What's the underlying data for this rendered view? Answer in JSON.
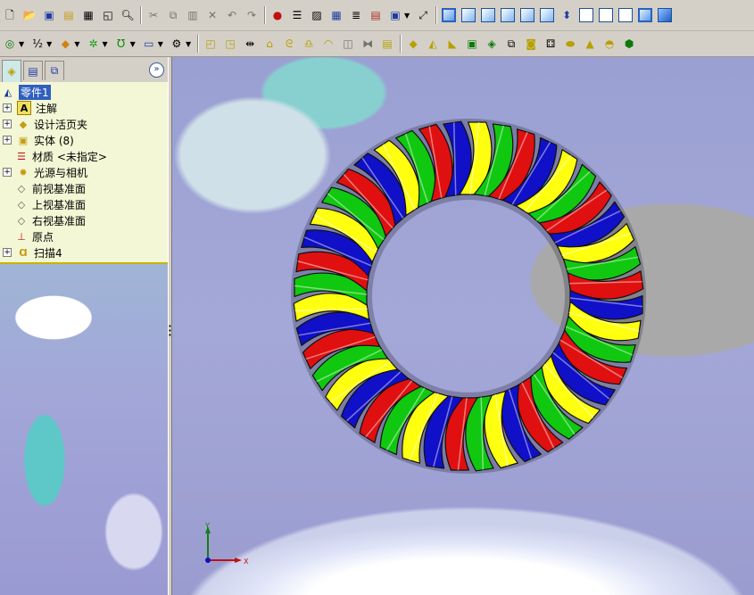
{
  "toolbar_top": {
    "file_icons": [
      "new-icon",
      "open-icon",
      "save-icon",
      "open-folder-icon",
      "print-icon",
      "print-preview-icon",
      "zoom-icon"
    ],
    "edit_icons": [
      "cut-icon",
      "copy-icon",
      "paste-icon",
      "delete-icon",
      "undo-icon",
      "redo-icon"
    ],
    "tool_icons": [
      "rebuild-icon",
      "options-icon",
      "layers-icon",
      "grid-icon",
      "list-icon",
      "brick-icon",
      "viewport-icon",
      "fit-icon"
    ],
    "view_cubes": [
      "front-view",
      "back-view",
      "left-view",
      "right-view",
      "top-view",
      "bottom-view",
      "isometric-view",
      "trimetric-view",
      "dimetric-view",
      "normal-to-view",
      "shaded-view"
    ]
  },
  "toolbar_feature": {
    "icons": [
      "sketch-icon",
      "smart-dimension-icon",
      "extrude-icon",
      "revolve-icon",
      "sweep-icon",
      "loft-icon",
      "fillet-icon",
      "chamfer-icon",
      "shell-icon",
      "rib-icon",
      "draft-icon",
      "hole-icon",
      "mirror-icon",
      "pattern-icon",
      "dome-icon",
      "curve-icon",
      "wrap-icon",
      "thread-icon",
      "helix-icon",
      "spring-icon"
    ]
  },
  "panel": {
    "tabs": [
      "feature-manager",
      "property-manager",
      "configuration-manager"
    ],
    "collapse_label": "»",
    "tree": [
      {
        "label": "零件1",
        "icon": "part-icon",
        "expandable": false,
        "root": true
      },
      {
        "label": "注解",
        "icon": "annotation-icon",
        "expandable": true
      },
      {
        "label": "设计活页夹",
        "icon": "design-binder-icon",
        "expandable": true
      },
      {
        "label": "实体 (8)",
        "icon": "solid-bodies-icon",
        "expandable": true
      },
      {
        "label": "材质 <未指定>",
        "icon": "material-icon",
        "expandable": false
      },
      {
        "label": "光源与相机",
        "icon": "lights-camera-icon",
        "expandable": true
      },
      {
        "label": "前视基准面",
        "icon": "plane-icon",
        "expandable": false
      },
      {
        "label": "上视基准面",
        "icon": "plane-icon",
        "expandable": false
      },
      {
        "label": "右视基准面",
        "icon": "plane-icon",
        "expandable": false
      },
      {
        "label": "原点",
        "icon": "origin-icon",
        "expandable": false
      },
      {
        "label": "扫描4",
        "icon": "sweep-feature-icon",
        "expandable": true
      }
    ]
  },
  "model": {
    "colors": [
      "#1010c8",
      "#ffff10",
      "#10c810",
      "#e01010"
    ],
    "inner_colors": [
      "#ffffff",
      "#ff10ff",
      "#10d0d0",
      "#c87010",
      "#a0a0a0"
    ]
  },
  "triad": {
    "x_label": "X",
    "y_label": "Y"
  }
}
